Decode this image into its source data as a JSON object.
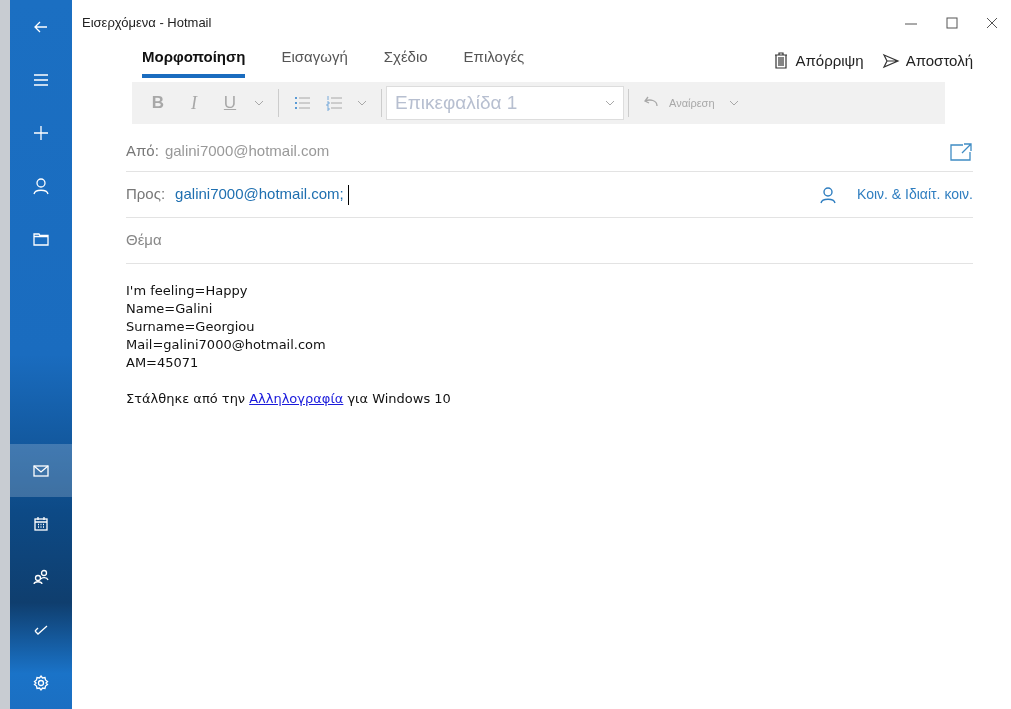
{
  "window": {
    "title": "Εισερχόμενα - Hotmail"
  },
  "sidebar": {
    "top_items": [
      {
        "kind": "back",
        "selected": false
      },
      {
        "kind": "menu",
        "selected": false
      },
      {
        "kind": "new",
        "selected": false
      },
      {
        "kind": "account",
        "selected": false
      },
      {
        "kind": "folder",
        "selected": false
      }
    ],
    "bottom_items": [
      {
        "kind": "mail",
        "selected": true
      },
      {
        "kind": "calendar",
        "selected": false
      },
      {
        "kind": "people",
        "selected": false
      },
      {
        "kind": "todo",
        "selected": false
      },
      {
        "kind": "settings",
        "selected": false
      }
    ]
  },
  "tabs": [
    {
      "label": "Μορφοποίηση",
      "selected": true
    },
    {
      "label": "Εισαγωγή",
      "selected": false
    },
    {
      "label": "Σχέδιο",
      "selected": false
    },
    {
      "label": "Επιλογές",
      "selected": false
    }
  ],
  "actions": [
    {
      "kind": "discard",
      "label": "Απόρριψη"
    },
    {
      "kind": "send",
      "label": "Αποστολή"
    }
  ],
  "toolbar": {
    "bold": "B",
    "italic": "I",
    "underline": "U",
    "style": "Επικεφαλίδα 1",
    "undo": "Αναίρεση",
    "disabled": true
  },
  "from": {
    "label": "Από:",
    "value": "galini7000@hotmail.com"
  },
  "to": {
    "label": "Προς:",
    "value": "galini7000@hotmail.com;",
    "cc_link": "Κοιν. & Ιδιαίτ. κοιν."
  },
  "subject": {
    "placeholder": "Θέμα"
  },
  "body": {
    "lines": [
      "I'm feeling=Happy",
      "Name=Galini",
      "Surname=Georgiou",
      "Mail=galini7000@hotmail.com",
      "AM=45071"
    ],
    "signature": {
      "before": "Στάλθηκε από την",
      "link": "Αλληλογραφία",
      "after": "για Windows 10"
    }
  }
}
